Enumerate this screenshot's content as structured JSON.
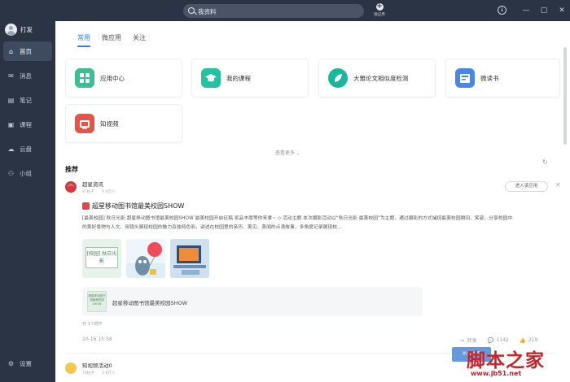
{
  "search": {
    "value": "我资料"
  },
  "topbar": {
    "add_label": "微应用"
  },
  "user": {
    "name": "打发"
  },
  "sidebar": {
    "items": [
      {
        "label": "首页",
        "icon": "home-icon",
        "active": true
      },
      {
        "label": "消息",
        "icon": "message-icon",
        "active": false
      },
      {
        "label": "笔记",
        "icon": "note-icon",
        "active": false
      },
      {
        "label": "课程",
        "icon": "course-icon",
        "active": false
      },
      {
        "label": "云盘",
        "icon": "cloud-icon",
        "active": false
      },
      {
        "label": "小组",
        "icon": "group-icon",
        "active": false
      }
    ],
    "settings": "设置"
  },
  "tabs": [
    {
      "label": "常用",
      "active": true
    },
    {
      "label": "微应用",
      "active": false
    },
    {
      "label": "关注",
      "active": false
    }
  ],
  "apps": [
    {
      "label": "应用中心",
      "icon": "grid-icon",
      "color": "#3bbf8f"
    },
    {
      "label": "我的课程",
      "icon": "graduation-cap-icon",
      "color": "#22c3a0"
    },
    {
      "label": "大雅论文相似度检测",
      "icon": "leaf-icon",
      "color": "#17b99a"
    },
    {
      "label": "微读书",
      "icon": "book-icon",
      "color": "#4a86e8"
    },
    {
      "label": "知视频",
      "icon": "tv-icon",
      "color": "#e2564a"
    }
  ],
  "more_label": "查看更多",
  "section_title": "推荐",
  "post": {
    "publisher": "超星资讯",
    "posts": "47帖子",
    "fans": "9.9万人",
    "enter_label": "进入该应用",
    "title": "超星移动图书馆最美校园SHOW",
    "body": "[最美校园] 秋日光影 超星移动图书馆最美校园SHOW 最美校园开启征稿 奖品丰厚等你来拿~ ◇ 活动主题 本次摄影活动以“秋日光影 最美校园”为主题，通过摄影的方式捕捉最美校园瞬间、笑容、分享校园中的美好景物与人文、用镜头展现校园的魅力及独特色彩，讲述在校园里的亲历、美见、美闻的点滴故事，多角度记录展现校…",
    "thumb1_text": "[校园] 秋日光影",
    "attachment": "超星移动图书馆最美校园SHOW",
    "attachment_thumb": "超星移动图书馆最美校园SHOW",
    "attach_count": "共 1个附件",
    "time": "10-16 15:58",
    "share": "转发",
    "comments": "1142",
    "likes": "219"
  },
  "next_post": {
    "publisher": "知视频活动0",
    "posts": "70帖子",
    "fans": "3.8万人"
  },
  "watermark": {
    "main": "脚本之家",
    "url": "www.jb51.net",
    "badge": "进入微应用"
  }
}
